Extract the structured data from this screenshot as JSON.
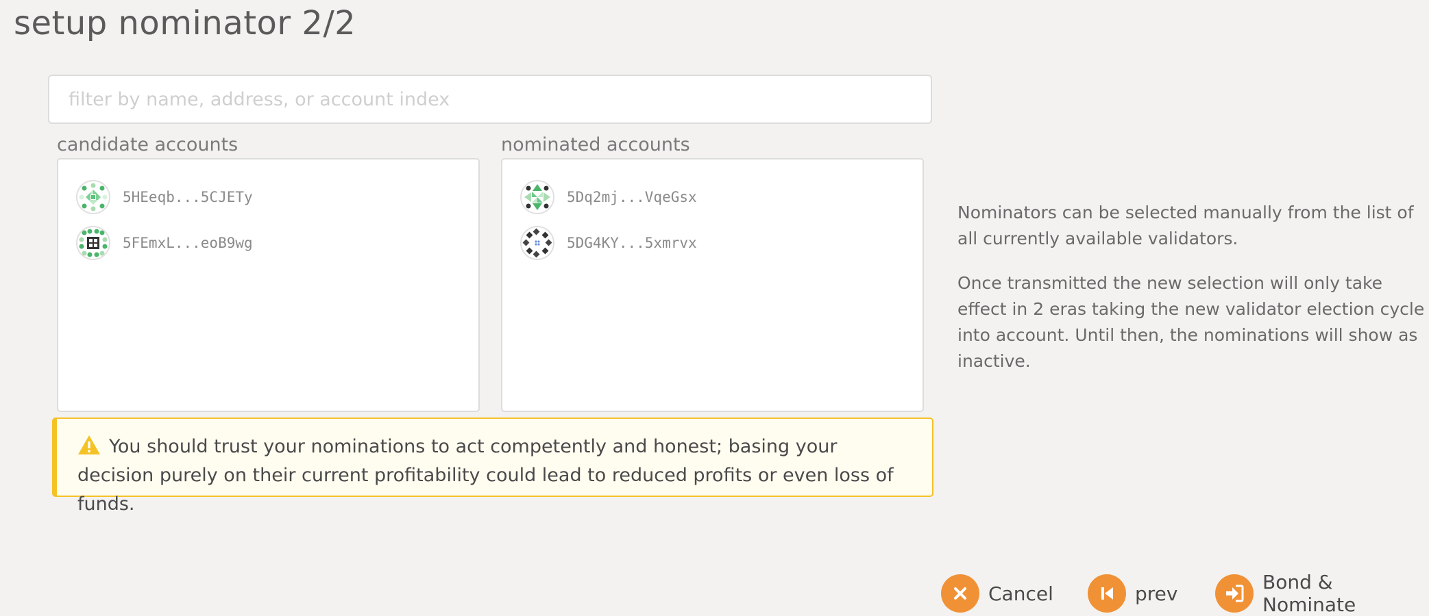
{
  "page": {
    "title": "setup nominator 2/2"
  },
  "filter": {
    "placeholder": "filter by name, address, or account index",
    "value": ""
  },
  "candidates": {
    "label": "candidate accounts",
    "accounts": [
      {
        "address": "5HEeqb...5CJETy",
        "icon": "identicon-green"
      },
      {
        "address": "5FEmxL...eoB9wg",
        "icon": "identicon-green-dark"
      }
    ]
  },
  "nominated": {
    "label": "nominated accounts",
    "accounts": [
      {
        "address": "5Dq2mj...VqeGsx",
        "icon": "identicon-green-dark"
      },
      {
        "address": "5DG4KY...5xmrvx",
        "icon": "identicon-dark"
      }
    ]
  },
  "warning": {
    "icon": "warning-icon",
    "text": "You should trust your nominations to act competently and honest; basing your decision purely on their current profitability could lead to reduced profits or even loss of funds."
  },
  "info": {
    "p1": "Nominators can be selected manually from the list of all currently available validators.",
    "p2": "Once transmitted the new selection will only take effect in 2 eras taking the new validator election cycle into account. Until then, the nominations will show as inactive."
  },
  "actions": {
    "cancel": {
      "label": "Cancel",
      "icon": "close-icon"
    },
    "prev": {
      "label": "prev",
      "icon": "step-backward-icon"
    },
    "bond": {
      "label": "Bond & Nominate",
      "icon": "sign-in-icon"
    }
  },
  "colors": {
    "accent": "#f19135",
    "warning_border": "#f5c226",
    "warning_bg": "#fffcf0",
    "background": "#f3f2f0"
  }
}
